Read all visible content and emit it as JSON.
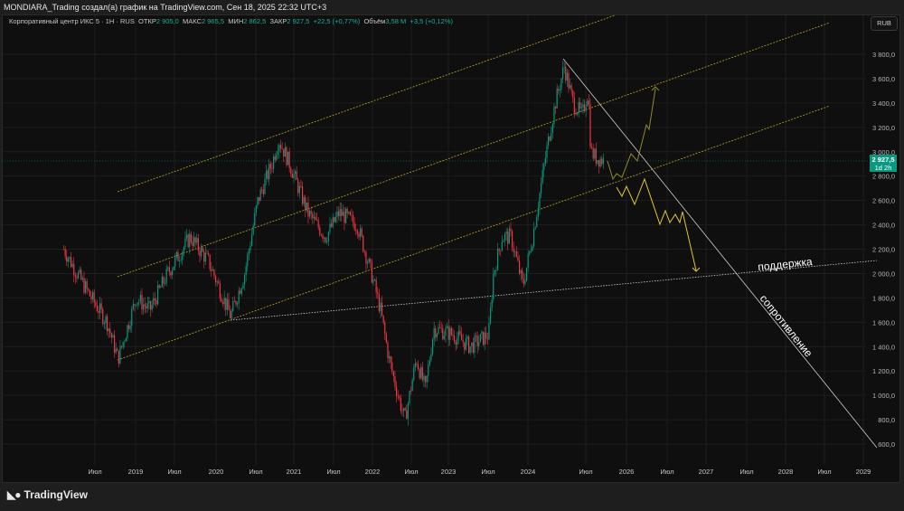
{
  "header": {
    "title": "MONDIARA_Trading создал(а) график на TradingView.com, Сен 18, 2025 22:32 UTC+3"
  },
  "legend": {
    "symbol": "Корпоративный центр ИКС 5 · 1Н · RUS",
    "open_label": "ОТКР",
    "open": "2 905,0",
    "high_label": "МАКС",
    "high": "2 965,5",
    "low_label": "МИН",
    "low": "2 862,5",
    "close_label": "ЗАКР",
    "close": "2 927,5",
    "change": "+22,5 (+0,77%)",
    "volume_label": "Объём",
    "volume": "3,58 M",
    "volume_change": "+3,5 (+0,12%)"
  },
  "currency_button": "RUB",
  "price_badge": {
    "price": "2 927,5",
    "countdown": "1d 2h",
    "color": "#089981"
  },
  "annotations": {
    "support": "поддержка",
    "resistance": "сопротивление"
  },
  "footer": {
    "brand": "TradingView"
  },
  "colors": {
    "up": "#089981",
    "down": "#f23645",
    "channel": "#b8a52a",
    "forecast": "#e0c62c",
    "forecast_alt": "#8f8a2a"
  },
  "chart_data": {
    "type": "candlestick",
    "title": "Корпоративный центр ИКС 5 · 1Н · RUS",
    "ylim": [
      600,
      3800
    ],
    "y_ticks": [
      "3 800,0",
      "3 600,0",
      "3 400,0",
      "3 200,0",
      "3 000,0",
      "2 800,0",
      "2 600,0",
      "2 400,0",
      "2 200,0",
      "2 000,0",
      "1 800,0",
      "1 600,0",
      "1 400,0",
      "1 200,0",
      "1 000,0",
      "800,0",
      "600,0"
    ],
    "x_ticks": [
      "Июл",
      "2019",
      "Июл",
      "2020",
      "Июл",
      "2021",
      "Июл",
      "2022",
      "Июл",
      "2023",
      "Июл",
      "2024",
      "Июл",
      "2026",
      "Июл",
      "2027",
      "Июл",
      "2028",
      "Июл",
      "2029"
    ],
    "price_path": [
      [
        2018.08,
        2200
      ],
      [
        2018.25,
        2000
      ],
      [
        2018.43,
        1800
      ],
      [
        2018.63,
        1600
      ],
      [
        2018.77,
        1300
      ],
      [
        2019.0,
        1800
      ],
      [
        2019.17,
        1700
      ],
      [
        2019.39,
        2000
      ],
      [
        2019.67,
        2300
      ],
      [
        2019.9,
        2100
      ],
      [
        2020.18,
        1650
      ],
      [
        2020.36,
        2000
      ],
      [
        2020.53,
        2600
      ],
      [
        2020.71,
        2900
      ],
      [
        2020.8,
        3100
      ],
      [
        2020.94,
        2900
      ],
      [
        2021.17,
        2500
      ],
      [
        2021.4,
        2300
      ],
      [
        2021.57,
        2500
      ],
      [
        2021.8,
        2400
      ],
      [
        2021.98,
        2000
      ],
      [
        2022.1,
        1700
      ],
      [
        2022.21,
        1300
      ],
      [
        2022.33,
        1000
      ],
      [
        2022.42,
        800
      ],
      [
        2022.57,
        1300
      ],
      [
        2022.69,
        1050
      ],
      [
        2022.8,
        1550
      ],
      [
        2023.05,
        1500
      ],
      [
        2023.27,
        1400
      ],
      [
        2023.5,
        1500
      ],
      [
        2023.56,
        2000
      ],
      [
        2023.67,
        2300
      ],
      [
        2023.78,
        2300
      ],
      [
        2023.93,
        1900
      ],
      [
        2024.07,
        2300
      ],
      [
        2024.3,
        3000
      ],
      [
        2024.45,
        3400
      ],
      [
        2024.6,
        3700
      ],
      [
        2024.75,
        3400
      ],
      [
        2024.9,
        3300
      ],
      [
        2025.0,
        3500
      ],
      [
        2025.05,
        3000
      ],
      [
        2025.15,
        2950
      ],
      [
        2025.3,
        2927.5
      ]
    ]
  }
}
